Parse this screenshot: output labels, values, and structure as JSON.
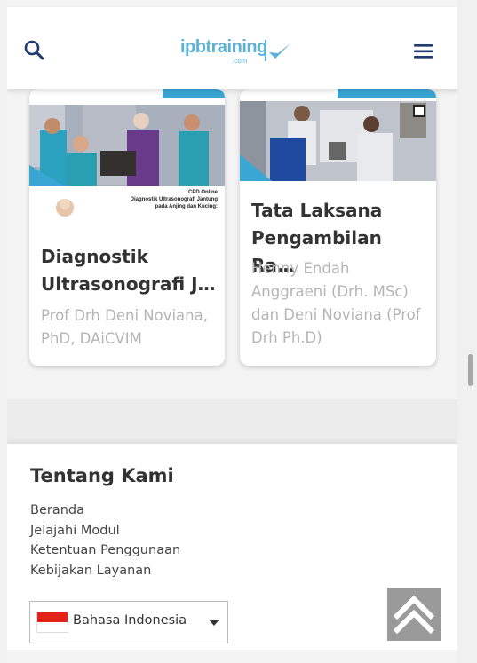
{
  "header": {
    "logo_text": "ipbtraining",
    "logo_sub": ".com",
    "search_icon": "search-icon",
    "menu_icon": "hamburger-menu-icon",
    "colors": {
      "brand": "#5bb2d8",
      "icon": "#1e3a6e"
    }
  },
  "courses": [
    {
      "title": "Diagnostik\nUltrasonografi J…",
      "author": "Prof Drh Deni Noviana, PhD, DAiCVIM",
      "thumb_caption_1": "CPD Online",
      "thumb_caption_2": "Diagnostik Ultrasonografi Jantung",
      "thumb_caption_3": "pada Anjing dan Kucing:"
    },
    {
      "title": "Tata Laksana\nPengambilan Ra…",
      "author": "Henny Endah Anggraeni (Drh. MSc) dan Deni Noviana (Prof Drh Ph.D)"
    }
  ],
  "footer": {
    "heading": "Tentang Kami",
    "links": [
      "Beranda",
      "Jelajahi Modul",
      "Ketentuan Penggunaan",
      "Kebijakan Layanan"
    ],
    "language": {
      "selected": "Bahasa Indonesia",
      "flag_icon": "indonesia-flag-icon"
    }
  },
  "scroll_top_icon": "double-chevron-up-icon"
}
